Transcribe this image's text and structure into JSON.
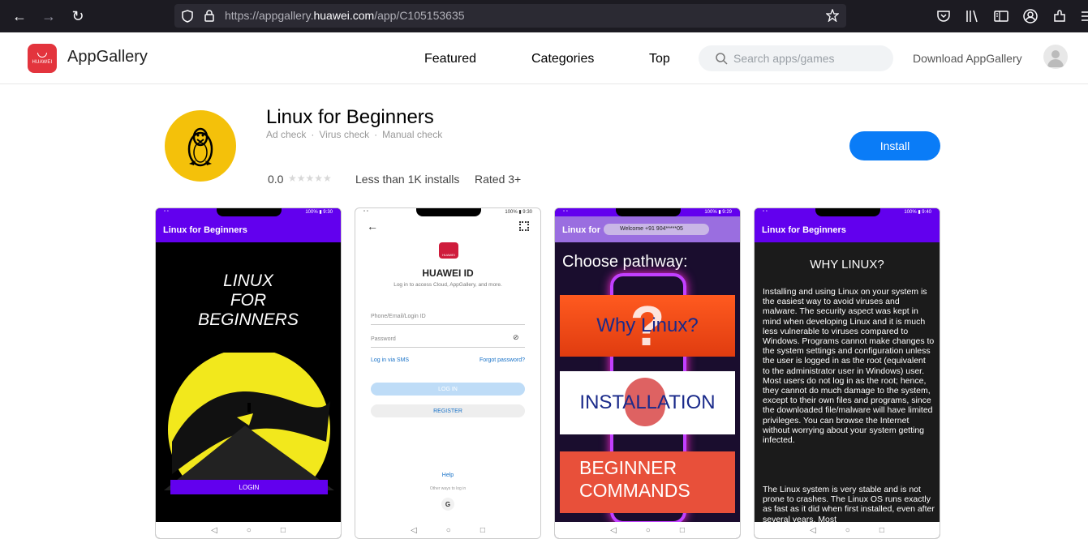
{
  "browser": {
    "url_prefix": "https://appgallery.",
    "url_domain": "huawei.com",
    "url_path": "/app/C105153635"
  },
  "header": {
    "logo_brand": "HUAWEI",
    "site_title": "AppGallery",
    "nav": [
      "Featured",
      "Categories",
      "Top"
    ],
    "search_placeholder": "Search apps/games",
    "download_label": "Download AppGallery"
  },
  "app": {
    "name": "Linux for Beginners",
    "checks": [
      "Ad check",
      "Virus check",
      "Manual check"
    ],
    "rating": "0.0",
    "installs": "Less than 1K installs",
    "rated": "Rated 3+",
    "install_label": "Install"
  },
  "screens": {
    "s1": {
      "status_right": "100% ▮ 9:30",
      "appbar": "Linux for Beginners",
      "title_lines": [
        "LINUX",
        "FOR",
        "BEGINNERS"
      ],
      "button": "LOGIN"
    },
    "s2": {
      "status_right": "100% ▮ 9:30",
      "logo_brand": "HUAWEI",
      "title": "HUAWEI ID",
      "subtitle": "Log in to access Cloud, AppGallery, and more.",
      "phone_placeholder": "Phone/Email/Login ID",
      "password_placeholder": "Password",
      "sms_link": "Log in via SMS",
      "forgot_link": "Forgot password?",
      "login_btn": "LOG IN",
      "register_btn": "REGISTER",
      "help": "Help",
      "other": "Other ways to log in",
      "google": "G"
    },
    "s3": {
      "status_right": "100% ▮ 9:29",
      "appbar": "Linux for",
      "toast": "Welcome +91 904*****05",
      "heading": "Choose pathway:",
      "card1": "Why Linux?",
      "card2": "INSTALLATION",
      "card3_l1": "BEGINNER",
      "card3_l2": "COMMANDS"
    },
    "s4": {
      "status_right": "100% ▮ 9:40",
      "appbar": "Linux for Beginners",
      "heading": "WHY LINUX?",
      "para1": "Installing and using Linux on your system is the easiest way to avoid viruses and malware. The security aspect was kept in mind when developing Linux and it is much less vulnerable to viruses compared to Windows. Programs cannot make changes to the system settings and configuration unless the user is logged in as the root (equivalent to the administrator user in Windows) user. Most users do not log in as the root; hence, they cannot do much damage to the system, except to their own files and programs, since the downloaded file/malware will have limited privileges. You can browse the Internet without worrying about your system getting infected.",
      "para2": "The Linux system is very stable and is not prone to crashes. The Linux OS runs exactly as fast as it did when first installed, even after several years. Most"
    }
  },
  "colors": {
    "install_blue": "#0a7cf7",
    "brand_red": "#e3343d",
    "app_icon_yellow": "#f4c10a",
    "appbar_purple": "#6200ee"
  }
}
